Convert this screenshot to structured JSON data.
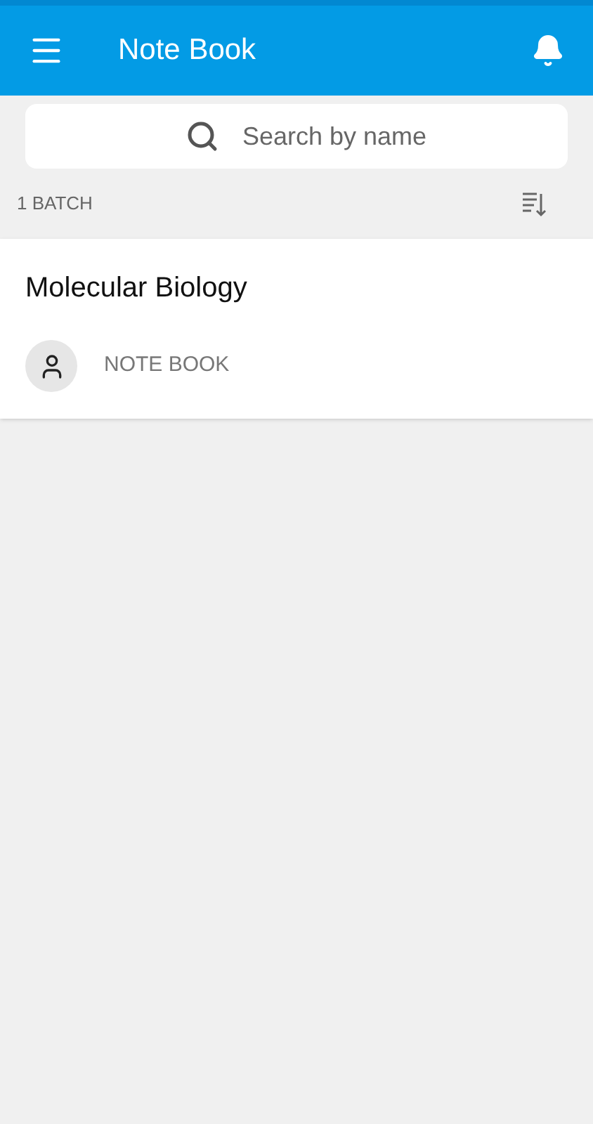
{
  "app_bar": {
    "title": "Note Book"
  },
  "search": {
    "placeholder": "Search by name"
  },
  "list_header": {
    "count": "1 BATCH"
  },
  "batches": [
    {
      "title": "Molecular Biology",
      "subtitle": "NOTE BOOK"
    }
  ]
}
